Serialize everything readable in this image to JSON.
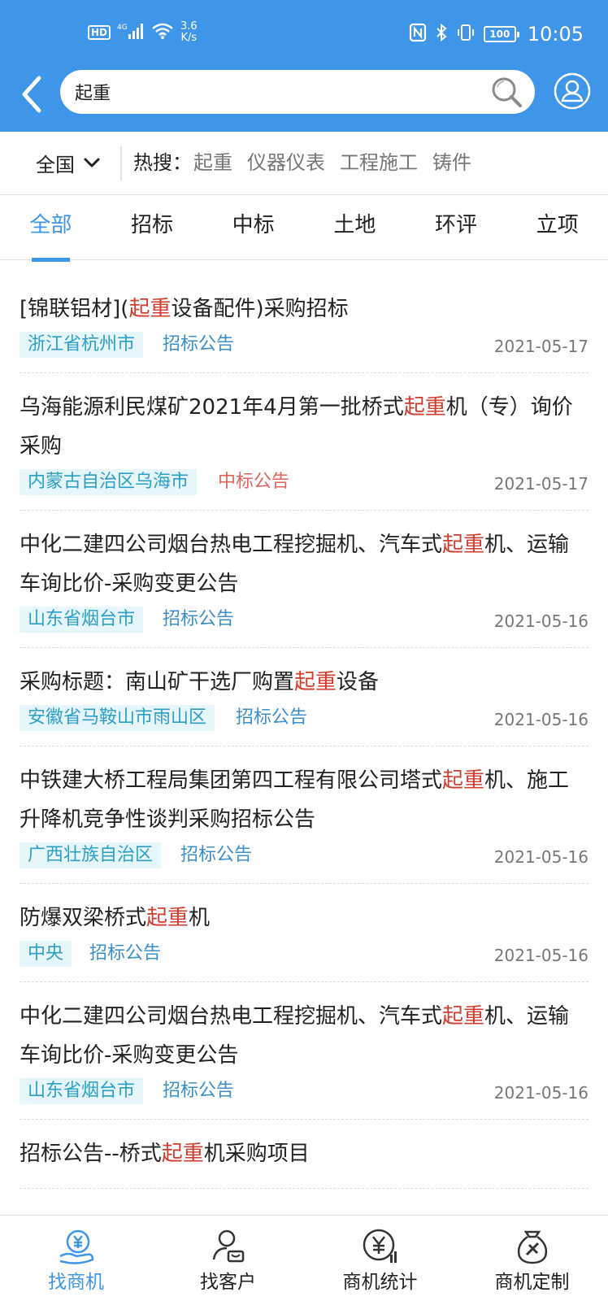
{
  "status_bar": {
    "hd": "HD",
    "network": "4G",
    "speed_value": "3.6",
    "speed_unit": "K/s",
    "battery": "100",
    "time": "10:05"
  },
  "search": {
    "query": "起重"
  },
  "filter": {
    "region": "全国",
    "hot_label": "热搜：",
    "hot_items": [
      "起重",
      "仪器仪表",
      "工程施工",
      "铸件"
    ]
  },
  "tabs": [
    {
      "label": "全部",
      "active": true
    },
    {
      "label": "招标"
    },
    {
      "label": "中标"
    },
    {
      "label": "土地"
    },
    {
      "label": "环评"
    },
    {
      "label": "立项"
    }
  ],
  "results": [
    {
      "title_pre": "[锦联铝材](",
      "highlight": "起重",
      "title_post": "设备配件)采购招标",
      "region": "浙江省杭州市",
      "type": "招标公告",
      "type_kind": "tender",
      "date": "2021-05-17"
    },
    {
      "title_pre": "乌海能源利民煤矿2021年4月第一批桥式",
      "highlight": "起重",
      "title_post": "机（专）询价采购",
      "region": "内蒙古自治区乌海市",
      "type": "中标公告",
      "type_kind": "award",
      "date": "2021-05-17"
    },
    {
      "title_pre": "中化二建四公司烟台热电工程挖掘机、汽车式",
      "highlight": "起重",
      "title_post": "机、运输车询比价-采购变更公告",
      "region": "山东省烟台市",
      "type": "招标公告",
      "type_kind": "tender",
      "date": "2021-05-16"
    },
    {
      "title_pre": "采购标题：南山矿干选厂购置",
      "highlight": "起重",
      "title_post": "设备",
      "region": "安徽省马鞍山市雨山区",
      "type": "招标公告",
      "type_kind": "tender",
      "date": "2021-05-16"
    },
    {
      "title_pre": "中铁建大桥工程局集团第四工程有限公司塔式",
      "highlight": "起重",
      "title_post": "机、施工升降机竞争性谈判采购招标公告",
      "region": "广西壮族自治区",
      "type": "招标公告",
      "type_kind": "tender",
      "date": "2021-05-16"
    },
    {
      "title_pre": "防爆双梁桥式",
      "highlight": "起重",
      "title_post": "机",
      "region": "中央",
      "type": "招标公告",
      "type_kind": "tender",
      "date": "2021-05-16"
    },
    {
      "title_pre": "中化二建四公司烟台热电工程挖掘机、汽车式",
      "highlight": "起重",
      "title_post": "机、运输车询比价-采购变更公告",
      "region": "山东省烟台市",
      "type": "招标公告",
      "type_kind": "tender",
      "date": "2021-05-16"
    },
    {
      "title_pre": "招标公告--桥式",
      "highlight": "起重",
      "title_post": "机采购项目",
      "region": "",
      "type": "",
      "type_kind": "tender",
      "date": ""
    }
  ],
  "bottom_nav": [
    {
      "label": "找商机",
      "icon": "yuan-hand-icon",
      "active": true
    },
    {
      "label": "找客户",
      "icon": "customer-icon"
    },
    {
      "label": "商机统计",
      "icon": "yuan-chart-icon"
    },
    {
      "label": "商机定制",
      "icon": "custom-bag-icon"
    }
  ],
  "colors": {
    "primary": "#3f95e8",
    "highlight": "#d03c2e",
    "award": "#e0635d",
    "region_tag_bg": "#e7f6fb"
  }
}
